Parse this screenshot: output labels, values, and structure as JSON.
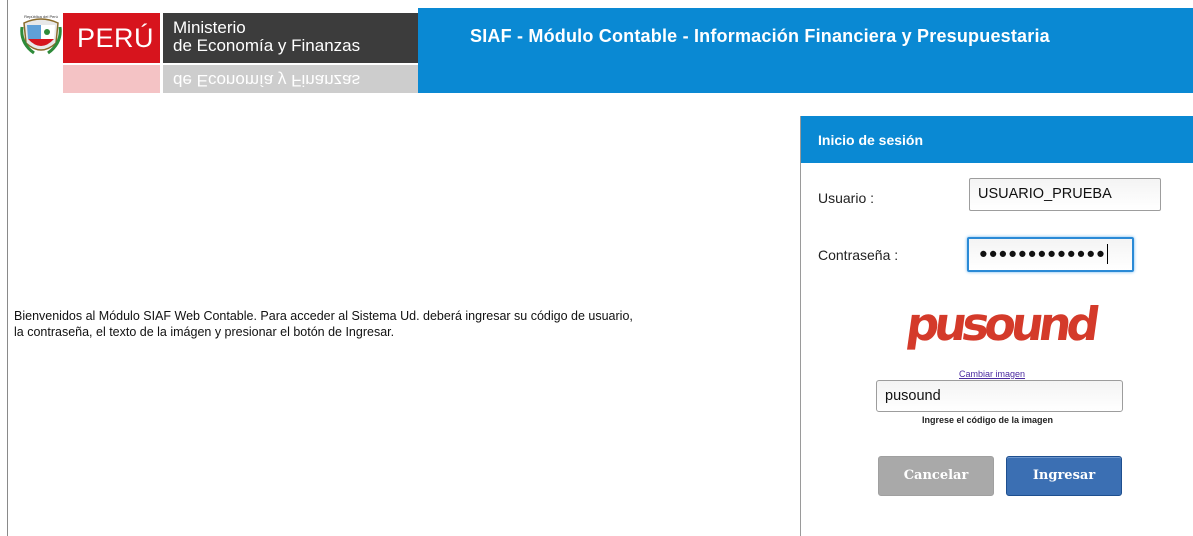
{
  "header": {
    "logo_small_text": "República del Perú",
    "peru": "PERÚ",
    "ministry_line1": "Ministerio",
    "ministry_line2": "de Economía y Finanzas",
    "title": "SIAF - Módulo Contable - Información Financiera y Presupuestaria"
  },
  "welcome": {
    "line1": "Bienvenidos al Módulo SIAF Web Contable. Para acceder al Sistema Ud. deberá ingresar su código de usuario,",
    "line2": "la contraseña, el texto de la imágen y presionar el botón de Ingresar."
  },
  "login": {
    "title": "Inicio de sesión",
    "user_label": "Usuario :",
    "user_value": "USUARIO_PRUEBA",
    "password_label": "Contraseña :",
    "password_masked": "●●●●●●●●●●●●●",
    "captcha_text": "pusound",
    "change_image": "Cambiar imagen",
    "code_value": "pusound",
    "code_help": "Ingrese el código de la imagen",
    "cancel_label": "Cancelar",
    "login_label": "Ingresar"
  },
  "colors": {
    "header_blue": "#0a89d3",
    "peru_red": "#d7141d",
    "ministry_dark": "#3c3c3c",
    "captcha_red": "#d43a2a",
    "button_blue": "#3b6fb3",
    "button_gray": "#a9a9a9"
  }
}
